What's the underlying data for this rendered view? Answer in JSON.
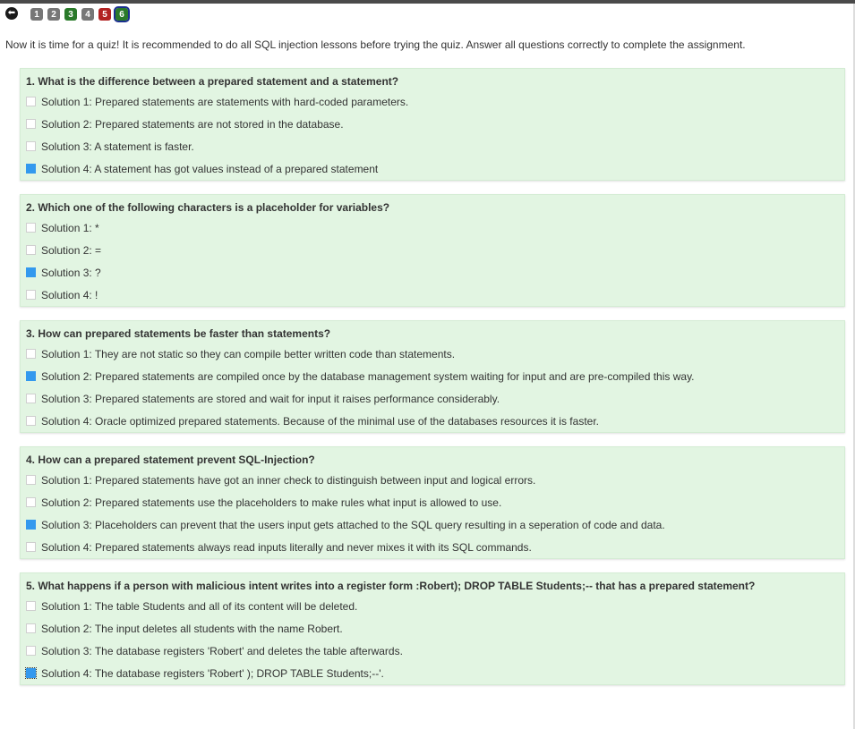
{
  "nav": {
    "back_icon": "arrow-left-icon",
    "back_glyph": "⬅",
    "pages": [
      {
        "label": "1",
        "color": "#777777"
      },
      {
        "label": "2",
        "color": "#777777"
      },
      {
        "label": "3",
        "color": "#2a7a2a"
      },
      {
        "label": "4",
        "color": "#777777"
      },
      {
        "label": "5",
        "color": "#b22222"
      },
      {
        "label": "6",
        "color": "#2a7a2a",
        "active": true
      }
    ]
  },
  "intro": "Now it is time for a quiz! It is recommended to do all SQL injection lessons before trying the quiz. Answer all questions correctly to complete the assignment.",
  "colors": {
    "question_bg": "#e2f5e2",
    "checked": "#3399ee"
  },
  "questions": [
    {
      "title": "1. What is the difference between a prepared statement and a statement?",
      "options": [
        {
          "label": "Solution 1: Prepared statements are statements with hard-coded parameters.",
          "checked": false
        },
        {
          "label": "Solution 2: Prepared statements are not stored in the database.",
          "checked": false
        },
        {
          "label": "Solution 3: A statement is faster.",
          "checked": false
        },
        {
          "label": "Solution 4: A statement has got values instead of a prepared statement",
          "checked": true
        }
      ]
    },
    {
      "title": "2. Which one of the following characters is a placeholder for variables?",
      "options": [
        {
          "label": "Solution 1: *",
          "checked": false
        },
        {
          "label": "Solution 2: =",
          "checked": false
        },
        {
          "label": "Solution 3: ?",
          "checked": true
        },
        {
          "label": "Solution 4: !",
          "checked": false
        }
      ]
    },
    {
      "title": "3. How can prepared statements be faster than statements?",
      "options": [
        {
          "label": "Solution 1: They are not static so they can compile better written code than statements.",
          "checked": false
        },
        {
          "label": "Solution 2: Prepared statements are compiled once by the database management system waiting for input and are pre-compiled this way.",
          "checked": true
        },
        {
          "label": "Solution 3: Prepared statements are stored and wait for input it raises performance considerably.",
          "checked": false
        },
        {
          "label": "Solution 4: Oracle optimized prepared statements. Because of the minimal use of the databases resources it is faster.",
          "checked": false
        }
      ]
    },
    {
      "title": "4. How can a prepared statement prevent SQL-Injection?",
      "options": [
        {
          "label": "Solution 1: Prepared statements have got an inner check to distinguish between input and logical errors.",
          "checked": false
        },
        {
          "label": "Solution 2: Prepared statements use the placeholders to make rules what input is allowed to use.",
          "checked": false
        },
        {
          "label": "Solution 3: Placeholders can prevent that the users input gets attached to the SQL query resulting in a seperation of code and data.",
          "checked": true
        },
        {
          "label": "Solution 4: Prepared statements always read inputs literally and never mixes it with its SQL commands.",
          "checked": false
        }
      ]
    },
    {
      "title": "5. What happens if a person with malicious intent writes into a register form :Robert); DROP TABLE Students;-- that has a prepared statement?",
      "options": [
        {
          "label": "Solution 1: The table Students and all of its content will be deleted.",
          "checked": false
        },
        {
          "label": "Solution 2: The input deletes all students with the name Robert.",
          "checked": false
        },
        {
          "label": "Solution 3: The database registers 'Robert' and deletes the table afterwards.",
          "checked": false
        },
        {
          "label": "Solution 4: The database registers 'Robert' ); DROP TABLE Students;--'.",
          "checked": true,
          "focused": true
        }
      ]
    }
  ]
}
